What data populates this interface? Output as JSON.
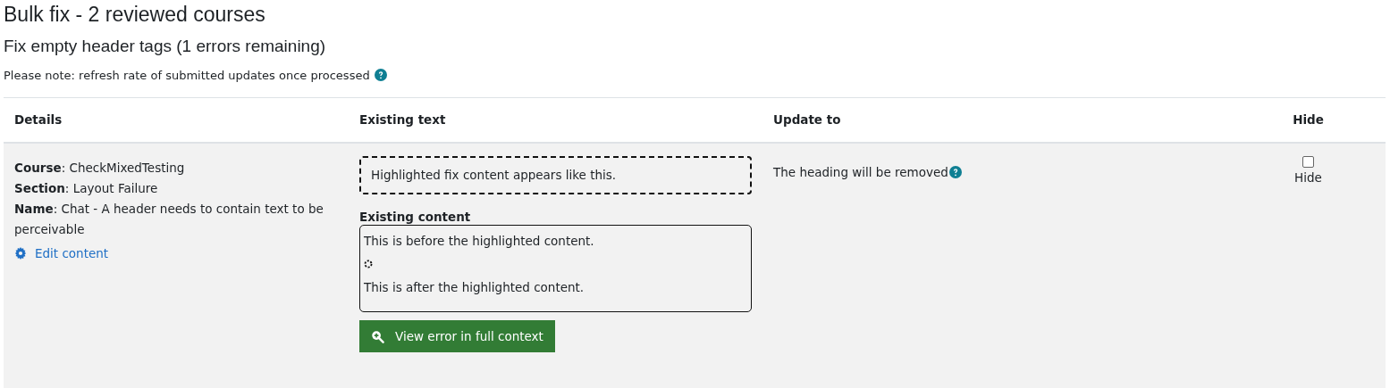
{
  "page": {
    "title": "Bulk fix - 2 reviewed courses",
    "subtitle": "Fix empty header tags (1 errors remaining)",
    "note": "Please note: refresh rate of submitted updates once processed"
  },
  "table": {
    "columns": [
      "Details",
      "Existing text",
      "Update to",
      "Hide"
    ],
    "rows": [
      {
        "details": [
          "**Course**: CheckMixedTesting",
          "**Section**: Layout Failure",
          "**Name**: Chat - A header needs to contain text to be perceivable"
        ],
        "edit_link": "Edit content",
        "highlight_sample": "Highlighted fix content appears like this.",
        "existing_label": "Existing content",
        "existing_lines": [
          {
            "kind": "text",
            "text": "This is before the highlighted content."
          },
          {
            "kind": "empty-heading"
          },
          {
            "kind": "text",
            "text": "This is after the highlighted content."
          }
        ],
        "view_button": "View error in full context",
        "update_text": "The heading will be removed",
        "hide": {
          "label": "Hide",
          "checked": false
        }
      }
    ]
  }
}
